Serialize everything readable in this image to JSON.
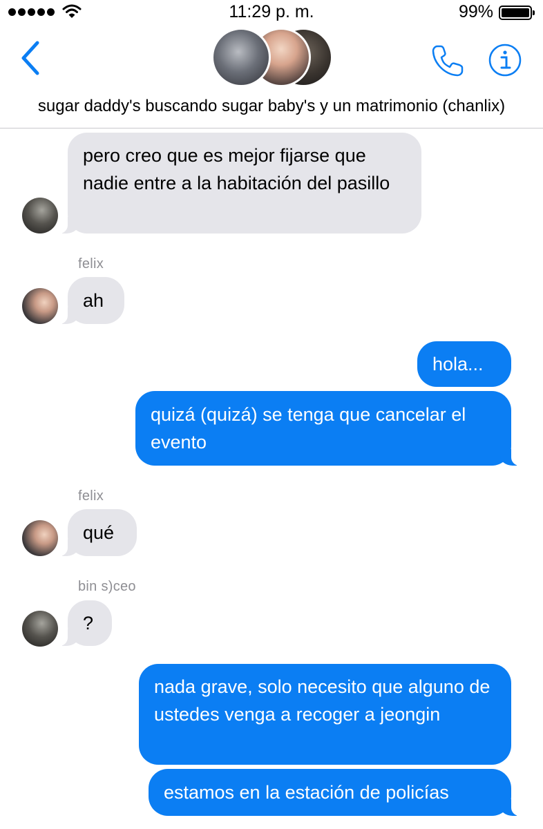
{
  "status_bar": {
    "time": "11:29 p. m.",
    "battery_percent": "99%",
    "signal_bars": 5,
    "icons": [
      "signal-dots-icon",
      "wifi-icon",
      "battery-icon"
    ]
  },
  "nav": {
    "back_icon": "chevron-left-icon",
    "call_icon": "phone-icon",
    "info_icon": "info-icon",
    "group_name": "sugar daddy's buscando sugar baby's y un matrimonio (chanlix)",
    "accent_color": "#0b7ef3"
  },
  "messages": [
    {
      "direction": "incoming",
      "sender": "",
      "text": "pero creo que es mejor fijarse que nadie entre a la habitación del pasillo"
    },
    {
      "direction": "incoming",
      "sender": "felix",
      "text": "ah"
    },
    {
      "direction": "outgoing",
      "text": "hola..."
    },
    {
      "direction": "outgoing",
      "text": "quizá (quizá) se tenga que cancelar el evento"
    },
    {
      "direction": "incoming",
      "sender": "felix",
      "text": "qué"
    },
    {
      "direction": "incoming",
      "sender": "bin s)ceo",
      "text": "?"
    },
    {
      "direction": "outgoing",
      "text": "nada grave, solo necesito que alguno de ustedes venga a recoger a jeongin"
    },
    {
      "direction": "outgoing",
      "text": "estamos en la estación de policías"
    }
  ],
  "colors": {
    "incoming_bubble": "#e5e5ea",
    "outgoing_bubble": "#0b7ef3",
    "sender_label": "#8e8e93"
  }
}
